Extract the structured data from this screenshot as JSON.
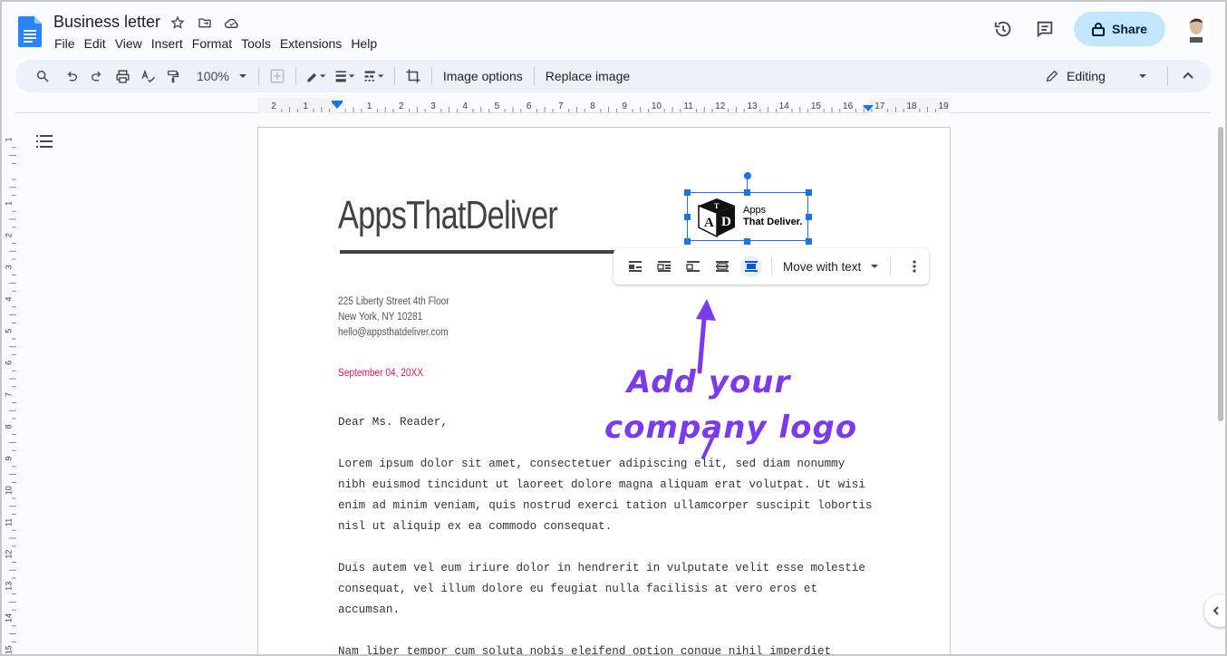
{
  "app": {
    "doc_title": "Business letter",
    "menu": [
      "File",
      "Edit",
      "View",
      "Insert",
      "Format",
      "Tools",
      "Extensions",
      "Help"
    ],
    "share_label": "Share"
  },
  "toolbar": {
    "zoom": "100%",
    "image_options": "Image options",
    "replace_image": "Replace image",
    "mode": "Editing"
  },
  "ruler": {
    "horizontal": [
      "2",
      "1",
      "",
      "1",
      "2",
      "3",
      "4",
      "5",
      "6",
      "7",
      "8",
      "9",
      "10",
      "11",
      "12",
      "13",
      "14",
      "15",
      "16",
      "17",
      "18",
      "19"
    ],
    "vertical": [
      "1",
      "",
      "1",
      "2",
      "3",
      "4",
      "5",
      "6",
      "7",
      "8",
      "9",
      "10",
      "11",
      "12",
      "13",
      "14",
      "15"
    ]
  },
  "document": {
    "company": "AppsThatDeliver",
    "address": [
      "225 Liberty Street 4th Floor",
      "New York, NY 10281",
      "hello@appsthatdeliver.com"
    ],
    "date": "September 04, 20XX",
    "greeting": "Dear Ms. Reader,",
    "para1": [
      "Lorem ipsum dolor sit amet, consectetuer adipiscing elit, sed diam nonummy",
      "nibh euismod tincidunt ut laoreet dolore magna aliquam erat volutpat. Ut wisi",
      "enim ad minim veniam, quis nostrud exerci tation ullamcorper suscipit lobortis",
      "nisl ut aliquip ex ea commodo consequat."
    ],
    "para2": [
      "Duis autem vel eum iriure dolor in hendrerit in vulputate velit esse molestie",
      "consequat, vel illum dolore eu feugiat nulla facilisis at vero eros et",
      "accumsan."
    ],
    "para3_start": "Nam liber tempor cum soluta nobis eleifend option congue nihil imperdiet"
  },
  "logo": {
    "line1": "Apps",
    "line2": "That Deliver.",
    "cube_letters": [
      "A",
      "D",
      "T"
    ]
  },
  "image_toolbar": {
    "wrap_mode": "Move with text",
    "active_wrap_index": 4
  },
  "annotation": {
    "line1": "Add your",
    "line2": "company logo",
    "color": "#7c3aed"
  },
  "colors": {
    "accent": "#1a73e8",
    "share_bg": "#c2e7ff",
    "date": "#d81b60"
  }
}
